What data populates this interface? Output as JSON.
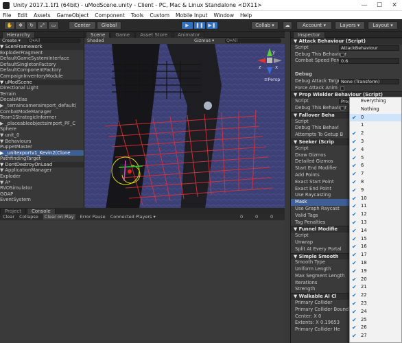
{
  "window": {
    "title": "Unity 2017.1.1f1 (64bit) - uModScene.unity - Client - PC, Mac & Linux Standalone <DX11>",
    "min": "—",
    "max": "☐",
    "close": "✕"
  },
  "menu": [
    "File",
    "Edit",
    "Assets",
    "GameObject",
    "Component",
    "Tools",
    "Custom",
    "Mobile Input",
    "Window",
    "Help"
  ],
  "toolbar": {
    "center": "Center",
    "global": "Global",
    "collab": "Collab ▾",
    "account": "Account",
    "layers": "Layers",
    "layout": "Layout"
  },
  "hierarchy": {
    "tab": "Hierarchy",
    "create": "Create ▾",
    "search": "Q▾All",
    "rows": [
      {
        "text": "▼ ScenFramework",
        "type": "scene"
      },
      {
        "text": "    ExploderFragment"
      },
      {
        "text": "    DefaultGameSystemInterface"
      },
      {
        "text": "    DefaultSingletonFactory"
      },
      {
        "text": "    DefaultComponentFactory"
      },
      {
        "text": "    CampaignInventoryModule"
      },
      {
        "text": "▼ uModScene",
        "type": "scene"
      },
      {
        "text": "    Directional Light"
      },
      {
        "text": "    Terrain"
      },
      {
        "text": "    DecalsAtlas"
      },
      {
        "text": "  ▶ _terraincameraimport_default("
      },
      {
        "text": "    CombatModeManager"
      },
      {
        "text": "    Team1StrategicInformer"
      },
      {
        "text": "  ▶ _placeableobjectsimport_PF_C"
      },
      {
        "text": "    Sphere"
      },
      {
        "text": "  ▼ unit_0"
      },
      {
        "text": "    ▼ Behaviours"
      },
      {
        "text": "        PuppetMaster"
      },
      {
        "text": "      ▶ _unitexportv1_Kevin2(Clone",
        "type": "sel"
      },
      {
        "text": "        PathfindingTarget"
      },
      {
        "text": "▼ DontDestroyOnLoad",
        "type": "scene"
      },
      {
        "text": "  ▼ ApplicationManager"
      },
      {
        "text": "      Exploder"
      },
      {
        "text": "    ▼ A*"
      },
      {
        "text": "        RVOSimulator"
      },
      {
        "text": "      GOAP"
      },
      {
        "text": "        EventSystem"
      }
    ]
  },
  "scene": {
    "tabs": [
      "Scene",
      "Game",
      "Asset Store",
      "Animator"
    ],
    "shaded": "Shaded",
    "gizmos": "Gizmos ▾",
    "search": "Q▾All",
    "persp": "≡Persp",
    "axis_y": "y",
    "axis_x": "x",
    "axis_z": "z"
  },
  "bottom": {
    "tabs": [
      "Project",
      "Console"
    ],
    "buttons": [
      "Clear",
      "Collapse",
      "Clear on Play",
      "Error Pause",
      "Connected Players ▾"
    ],
    "counts": [
      "0",
      "0",
      "0"
    ]
  },
  "inspector": {
    "tab": "Inspector",
    "rows": [
      {
        "text": "▼ Attack Behaviour (Script)",
        "type": "comp"
      },
      {
        "text": "Script",
        "val": "AttackBehaviour"
      },
      {
        "text": "Debug This Behaviour",
        "check": true
      },
      {
        "text": "Combat Speed Perc",
        "val": "0.6"
      },
      {
        "text": "",
        "type": "blank"
      },
      {
        "text": "Debug",
        "type": "bold"
      },
      {
        "text": "Debug Attack Target",
        "val": "None (Transform)"
      },
      {
        "text": "Force Attack Anim",
        "check": true
      },
      {
        "text": "▼ Prop Wielder Behaviour (Script)",
        "type": "comp"
      },
      {
        "text": "Script",
        "val": "PropWielderBehavi"
      },
      {
        "text": "Debug This Behaviour",
        "check": true
      },
      {
        "text": "▼ Fallover Beha",
        "type": "comp"
      },
      {
        "text": "Script"
      },
      {
        "text": "Debug This Behavi"
      },
      {
        "text": "Attempts To Getup B"
      },
      {
        "text": "▼ Seeker (Scrip",
        "type": "comp"
      },
      {
        "text": "Script"
      },
      {
        "text": "Draw Gizmos"
      },
      {
        "text": "Detailed Gizmos"
      },
      {
        "text": "Start End Modifier"
      },
      {
        "text": "   Add Points"
      },
      {
        "text": "   Exact Start Point"
      },
      {
        "text": "   Exact End Point"
      },
      {
        "text": "   Use Raycasting"
      },
      {
        "text": "   Mask",
        "type": "mask"
      },
      {
        "text": "   Use Graph Raycast"
      },
      {
        "text": "Valid Tags"
      },
      {
        "text": "Tag Penalties"
      },
      {
        "text": "▼ Funnel Modifie",
        "type": "comp"
      },
      {
        "text": "Script"
      },
      {
        "text": "Unwrap"
      },
      {
        "text": "Split At Every Portal"
      },
      {
        "text": "▼ Simple Smooth",
        "type": "comp"
      },
      {
        "text": "Smooth Type"
      },
      {
        "text": "Uniform Length"
      },
      {
        "text": "Max Segment Length"
      },
      {
        "text": "Iterations"
      },
      {
        "text": "Strength"
      },
      {
        "text": "▼ Walkable AI Cl",
        "type": "comp"
      },
      {
        "text": "Primary Collider"
      },
      {
        "text": "Primary Collider Bound"
      },
      {
        "text": "   Center:  X  0"
      },
      {
        "text": "   Extents: X  0.19653"
      },
      {
        "text": "Primary Collider He"
      }
    ]
  },
  "dropdown": {
    "items": [
      {
        "label": "Everything",
        "checked": false
      },
      {
        "label": "Nothing",
        "checked": false
      },
      {
        "label": "0",
        "checked": true,
        "hl": true
      },
      {
        "label": "1",
        "checked": false
      },
      {
        "label": "2",
        "checked": true
      },
      {
        "label": "3",
        "checked": true
      },
      {
        "label": "4",
        "checked": true
      },
      {
        "label": "5",
        "checked": true
      },
      {
        "label": "6",
        "checked": true
      },
      {
        "label": "7",
        "checked": true
      },
      {
        "label": "8",
        "checked": true
      },
      {
        "label": "9",
        "checked": true
      },
      {
        "label": "10",
        "checked": true
      },
      {
        "label": "11",
        "checked": true
      },
      {
        "label": "12",
        "checked": true
      },
      {
        "label": "13",
        "checked": true
      },
      {
        "label": "14",
        "checked": true
      },
      {
        "label": "15",
        "checked": true
      },
      {
        "label": "16",
        "checked": true
      },
      {
        "label": "17",
        "checked": true
      },
      {
        "label": "18",
        "checked": true
      },
      {
        "label": "19",
        "checked": true
      },
      {
        "label": "20",
        "checked": true
      },
      {
        "label": "21",
        "checked": true
      },
      {
        "label": "22",
        "checked": true
      },
      {
        "label": "23",
        "checked": true
      },
      {
        "label": "24",
        "checked": true
      },
      {
        "label": "25",
        "checked": true
      },
      {
        "label": "26",
        "checked": true
      },
      {
        "label": "27",
        "checked": true
      }
    ]
  }
}
